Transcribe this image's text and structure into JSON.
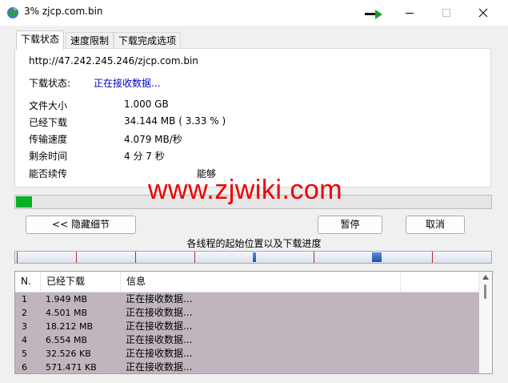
{
  "window": {
    "title": "3% zjcp.com.bin"
  },
  "tabs": [
    {
      "label": "下载状态",
      "active": true
    },
    {
      "label": "速度限制",
      "active": false
    },
    {
      "label": "下载完成选项",
      "active": false
    }
  ],
  "status": {
    "url": "http://47.242.245.246/zjcp.com.bin",
    "status_label": "下载状态:",
    "status_value": "正在接收数据...",
    "rows": [
      {
        "label": "文件大小",
        "value": "1.000  GB"
      },
      {
        "label": "已经下载",
        "value": "34.144  MB  ( 3.33 % )"
      },
      {
        "label": "传输速度",
        "value": "4.079  MB/秒"
      },
      {
        "label": "剩余时间",
        "value": "4 分 7 秒"
      },
      {
        "label": "能否续传",
        "value": "能够"
      }
    ]
  },
  "progress": {
    "percent": 3.33
  },
  "watermark": "www.zjwiki.com",
  "buttons": {
    "hide_details": "<< 隐藏细节",
    "pause": "暂停",
    "cancel": "取消"
  },
  "threads": {
    "title": "各线程的起始位置以及下载进度"
  },
  "list": {
    "headers": {
      "n": "N.",
      "downloaded": "已经下载",
      "info": "信息"
    },
    "rows": [
      {
        "n": "1",
        "downloaded": "1.949 MB",
        "info": "正在接收数据..."
      },
      {
        "n": "2",
        "downloaded": "4.501 MB",
        "info": "正在接收数据..."
      },
      {
        "n": "3",
        "downloaded": "18.212 MB",
        "info": "正在接收数据..."
      },
      {
        "n": "4",
        "downloaded": "6.554 MB",
        "info": "正在接收数据..."
      },
      {
        "n": "5",
        "downloaded": "32.526 KB",
        "info": "正在接收数据..."
      },
      {
        "n": "6",
        "downloaded": "571.471 KB",
        "info": "正在接收数据..."
      }
    ]
  },
  "colors": {
    "progress_fill": "#06b025",
    "status_value": "#0000cc",
    "watermark": "#ee0000",
    "row_highlight": "#c0b5be"
  },
  "icons": {
    "app": "idm-globe-icon",
    "arrow": "green-arrow-icon",
    "minimize": "minimize-icon",
    "maximize": "maximize-icon",
    "close": "close-icon"
  }
}
